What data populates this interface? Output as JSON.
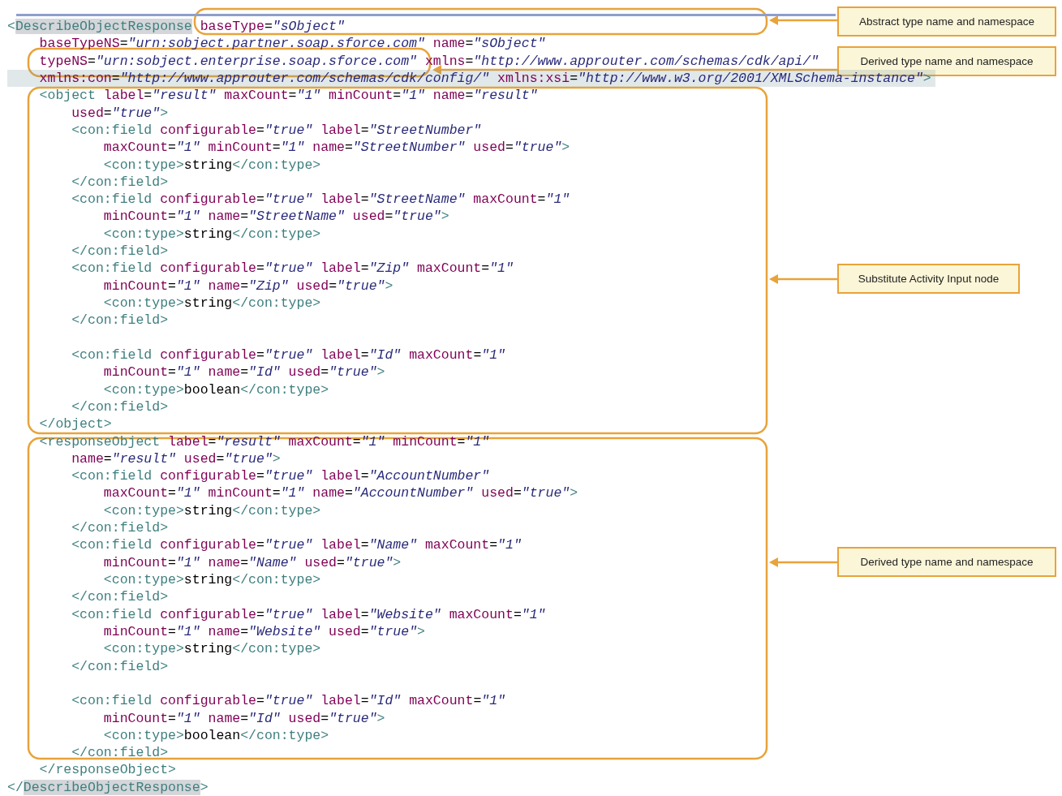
{
  "code_lines": [
    {
      "kind": "code",
      "highlighted": false,
      "segments": [
        {
          "kind": "tag",
          "text": "<"
        },
        {
          "kind": "tag",
          "text": "DescribeObjectResponse",
          "highlighted": true
        },
        {
          "kind": "attr",
          "text": " baseType"
        },
        {
          "kind": "eq",
          "text": "="
        },
        {
          "kind": "value",
          "text": "\"sObject\""
        }
      ]
    },
    {
      "kind": "code",
      "highlighted": false,
      "segments": [
        {
          "kind": "attr",
          "text": "    baseTypeNS"
        },
        {
          "kind": "eq",
          "text": "="
        },
        {
          "kind": "value",
          "text": "\"urn:sobject.partner.soap.sforce.com\""
        },
        {
          "kind": "attr",
          "text": " name"
        },
        {
          "kind": "eq",
          "text": "="
        },
        {
          "kind": "value",
          "text": "\"sObject\""
        }
      ]
    },
    {
      "kind": "code",
      "highlighted": false,
      "segments": [
        {
          "kind": "attr",
          "text": "    typeNS"
        },
        {
          "kind": "eq",
          "text": "="
        },
        {
          "kind": "value",
          "text": "\"urn:sobject.enterprise.soap.sforce.com\""
        }
      ],
      "tail_segments": [
        {
          "kind": "attr",
          "text": " xmlns"
        },
        {
          "kind": "eq",
          "text": "="
        },
        {
          "kind": "value",
          "text": "\"http://www.approuter.com/schemas/cdk/api/\""
        }
      ]
    },
    {
      "kind": "code",
      "highlighted": true,
      "segments": [
        {
          "kind": "attr",
          "text": "    xmlns:con"
        },
        {
          "kind": "eq",
          "text": "="
        },
        {
          "kind": "value",
          "text": "\"http://www.approuter.com/schemas/cdk/config/\""
        },
        {
          "kind": "attr",
          "text": " xmlns:xsi"
        },
        {
          "kind": "eq",
          "text": "="
        },
        {
          "kind": "value",
          "text": "\"http://www.w3.org/2001/XMLSchema-instance\""
        },
        {
          "kind": "tag",
          "text": ">"
        }
      ]
    },
    {
      "kind": "code",
      "highlighted": false,
      "segments": [
        {
          "kind": "tag",
          "text": "    <object"
        },
        {
          "kind": "attr",
          "text": " label"
        },
        {
          "kind": "eq",
          "text": "="
        },
        {
          "kind": "value",
          "text": "\"result\""
        },
        {
          "kind": "attr",
          "text": " maxCount"
        },
        {
          "kind": "eq",
          "text": "="
        },
        {
          "kind": "value",
          "text": "\"1\""
        },
        {
          "kind": "attr",
          "text": " minCount"
        },
        {
          "kind": "eq",
          "text": "="
        },
        {
          "kind": "value",
          "text": "\"1\""
        },
        {
          "kind": "attr",
          "text": " name"
        },
        {
          "kind": "eq",
          "text": "="
        },
        {
          "kind": "value",
          "text": "\"result\""
        }
      ]
    },
    {
      "kind": "code",
      "highlighted": false,
      "segments": [
        {
          "kind": "attr",
          "text": "        used"
        },
        {
          "kind": "eq",
          "text": "="
        },
        {
          "kind": "value",
          "text": "\"true\""
        },
        {
          "kind": "tag",
          "text": ">"
        }
      ]
    },
    {
      "kind": "code",
      "highlighted": false,
      "segments": [
        {
          "kind": "tag",
          "text": "        <con:field"
        },
        {
          "kind": "attr",
          "text": " configurable"
        },
        {
          "kind": "eq",
          "text": "="
        },
        {
          "kind": "value",
          "text": "\"true\""
        },
        {
          "kind": "attr",
          "text": " label"
        },
        {
          "kind": "eq",
          "text": "="
        },
        {
          "kind": "value",
          "text": "\"StreetNumber\""
        }
      ]
    },
    {
      "kind": "code",
      "highlighted": false,
      "segments": [
        {
          "kind": "attr",
          "text": "            maxCount"
        },
        {
          "kind": "eq",
          "text": "="
        },
        {
          "kind": "value",
          "text": "\"1\""
        },
        {
          "kind": "attr",
          "text": " minCount"
        },
        {
          "kind": "eq",
          "text": "="
        },
        {
          "kind": "value",
          "text": "\"1\""
        },
        {
          "kind": "attr",
          "text": " name"
        },
        {
          "kind": "eq",
          "text": "="
        },
        {
          "kind": "value",
          "text": "\"StreetNumber\""
        },
        {
          "kind": "attr",
          "text": " used"
        },
        {
          "kind": "eq",
          "text": "="
        },
        {
          "kind": "value",
          "text": "\"true\""
        },
        {
          "kind": "tag",
          "text": ">"
        }
      ]
    },
    {
      "kind": "code",
      "highlighted": false,
      "segments": [
        {
          "kind": "tag",
          "text": "            <con:type>"
        },
        {
          "kind": "text",
          "text": "string"
        },
        {
          "kind": "tag",
          "text": "</con:type>"
        }
      ]
    },
    {
      "kind": "code",
      "highlighted": false,
      "segments": [
        {
          "kind": "tag",
          "text": "        </con:field>"
        }
      ]
    },
    {
      "kind": "code",
      "highlighted": false,
      "segments": [
        {
          "kind": "tag",
          "text": "        <con:field"
        },
        {
          "kind": "attr",
          "text": " configurable"
        },
        {
          "kind": "eq",
          "text": "="
        },
        {
          "kind": "value",
          "text": "\"true\""
        },
        {
          "kind": "attr",
          "text": " label"
        },
        {
          "kind": "eq",
          "text": "="
        },
        {
          "kind": "value",
          "text": "\"StreetName\""
        },
        {
          "kind": "attr",
          "text": " maxCount"
        },
        {
          "kind": "eq",
          "text": "="
        },
        {
          "kind": "value",
          "text": "\"1\""
        }
      ]
    },
    {
      "kind": "code",
      "highlighted": false,
      "segments": [
        {
          "kind": "attr",
          "text": "            minCount"
        },
        {
          "kind": "eq",
          "text": "="
        },
        {
          "kind": "value",
          "text": "\"1\""
        },
        {
          "kind": "attr",
          "text": " name"
        },
        {
          "kind": "eq",
          "text": "="
        },
        {
          "kind": "value",
          "text": "\"StreetName\""
        },
        {
          "kind": "attr",
          "text": " used"
        },
        {
          "kind": "eq",
          "text": "="
        },
        {
          "kind": "value",
          "text": "\"true\""
        },
        {
          "kind": "tag",
          "text": ">"
        }
      ]
    },
    {
      "kind": "code",
      "highlighted": false,
      "segments": [
        {
          "kind": "tag",
          "text": "            <con:type>"
        },
        {
          "kind": "text",
          "text": "string"
        },
        {
          "kind": "tag",
          "text": "</con:type>"
        }
      ]
    },
    {
      "kind": "code",
      "highlighted": false,
      "segments": [
        {
          "kind": "tag",
          "text": "        </con:field>"
        }
      ]
    },
    {
      "kind": "code",
      "highlighted": false,
      "segments": [
        {
          "kind": "tag",
          "text": "        <con:field"
        },
        {
          "kind": "attr",
          "text": " configurable"
        },
        {
          "kind": "eq",
          "text": "="
        },
        {
          "kind": "value",
          "text": "\"true\""
        },
        {
          "kind": "attr",
          "text": " label"
        },
        {
          "kind": "eq",
          "text": "="
        },
        {
          "kind": "value",
          "text": "\"Zip\""
        },
        {
          "kind": "attr",
          "text": " maxCount"
        },
        {
          "kind": "eq",
          "text": "="
        },
        {
          "kind": "value",
          "text": "\"1\""
        }
      ]
    },
    {
      "kind": "code",
      "highlighted": false,
      "segments": [
        {
          "kind": "attr",
          "text": "            minCount"
        },
        {
          "kind": "eq",
          "text": "="
        },
        {
          "kind": "value",
          "text": "\"1\""
        },
        {
          "kind": "attr",
          "text": " name"
        },
        {
          "kind": "eq",
          "text": "="
        },
        {
          "kind": "value",
          "text": "\"Zip\""
        },
        {
          "kind": "attr",
          "text": " used"
        },
        {
          "kind": "eq",
          "text": "="
        },
        {
          "kind": "value",
          "text": "\"true\""
        },
        {
          "kind": "tag",
          "text": ">"
        }
      ]
    },
    {
      "kind": "code",
      "highlighted": false,
      "segments": [
        {
          "kind": "tag",
          "text": "            <con:type>"
        },
        {
          "kind": "text",
          "text": "string"
        },
        {
          "kind": "tag",
          "text": "</con:type>"
        }
      ]
    },
    {
      "kind": "code",
      "highlighted": false,
      "segments": [
        {
          "kind": "tag",
          "text": "        </con:field>"
        }
      ]
    },
    {
      "kind": "blank",
      "highlighted": false
    },
    {
      "kind": "code",
      "highlighted": false,
      "segments": [
        {
          "kind": "tag",
          "text": "        <con:field"
        },
        {
          "kind": "attr",
          "text": " configurable"
        },
        {
          "kind": "eq",
          "text": "="
        },
        {
          "kind": "value",
          "text": "\"true\""
        },
        {
          "kind": "attr",
          "text": " label"
        },
        {
          "kind": "eq",
          "text": "="
        },
        {
          "kind": "value",
          "text": "\"Id\""
        },
        {
          "kind": "attr",
          "text": " maxCount"
        },
        {
          "kind": "eq",
          "text": "="
        },
        {
          "kind": "value",
          "text": "\"1\""
        }
      ]
    },
    {
      "kind": "code",
      "highlighted": false,
      "segments": [
        {
          "kind": "attr",
          "text": "            minCount"
        },
        {
          "kind": "eq",
          "text": "="
        },
        {
          "kind": "value",
          "text": "\"1\""
        },
        {
          "kind": "attr",
          "text": " name"
        },
        {
          "kind": "eq",
          "text": "="
        },
        {
          "kind": "value",
          "text": "\"Id\""
        },
        {
          "kind": "attr",
          "text": " used"
        },
        {
          "kind": "eq",
          "text": "="
        },
        {
          "kind": "value",
          "text": "\"true\""
        },
        {
          "kind": "tag",
          "text": ">"
        }
      ]
    },
    {
      "kind": "code",
      "highlighted": false,
      "segments": [
        {
          "kind": "tag",
          "text": "            <con:type>"
        },
        {
          "kind": "text",
          "text": "boolean"
        },
        {
          "kind": "tag",
          "text": "</con:type>"
        }
      ]
    },
    {
      "kind": "code",
      "highlighted": false,
      "segments": [
        {
          "kind": "tag",
          "text": "        </con:field>"
        }
      ]
    },
    {
      "kind": "code",
      "highlighted": false,
      "segments": [
        {
          "kind": "tag",
          "text": "    </object>"
        }
      ]
    },
    {
      "kind": "code",
      "highlighted": false,
      "segments": [
        {
          "kind": "tag",
          "text": "    <responseObject"
        },
        {
          "kind": "attr",
          "text": " label"
        },
        {
          "kind": "eq",
          "text": "="
        },
        {
          "kind": "value",
          "text": "\"result\""
        },
        {
          "kind": "attr",
          "text": " maxCount"
        },
        {
          "kind": "eq",
          "text": "="
        },
        {
          "kind": "value",
          "text": "\"1\""
        },
        {
          "kind": "attr",
          "text": " minCount"
        },
        {
          "kind": "eq",
          "text": "="
        },
        {
          "kind": "value",
          "text": "\"1\""
        }
      ]
    },
    {
      "kind": "code",
      "highlighted": false,
      "segments": [
        {
          "kind": "attr",
          "text": "        name"
        },
        {
          "kind": "eq",
          "text": "="
        },
        {
          "kind": "value",
          "text": "\"result\""
        },
        {
          "kind": "attr",
          "text": " used"
        },
        {
          "kind": "eq",
          "text": "="
        },
        {
          "kind": "value",
          "text": "\"true\""
        },
        {
          "kind": "tag",
          "text": ">"
        }
      ]
    },
    {
      "kind": "code",
      "highlighted": false,
      "segments": [
        {
          "kind": "tag",
          "text": "        <con:field"
        },
        {
          "kind": "attr",
          "text": " configurable"
        },
        {
          "kind": "eq",
          "text": "="
        },
        {
          "kind": "value",
          "text": "\"true\""
        },
        {
          "kind": "attr",
          "text": " label"
        },
        {
          "kind": "eq",
          "text": "="
        },
        {
          "kind": "value",
          "text": "\"AccountNumber\""
        }
      ]
    },
    {
      "kind": "code",
      "highlighted": false,
      "segments": [
        {
          "kind": "attr",
          "text": "            maxCount"
        },
        {
          "kind": "eq",
          "text": "="
        },
        {
          "kind": "value",
          "text": "\"1\""
        },
        {
          "kind": "attr",
          "text": " minCount"
        },
        {
          "kind": "eq",
          "text": "="
        },
        {
          "kind": "value",
          "text": "\"1\""
        },
        {
          "kind": "attr",
          "text": " name"
        },
        {
          "kind": "eq",
          "text": "="
        },
        {
          "kind": "value",
          "text": "\"AccountNumber\""
        },
        {
          "kind": "attr",
          "text": " used"
        },
        {
          "kind": "eq",
          "text": "="
        },
        {
          "kind": "value",
          "text": "\"true\""
        },
        {
          "kind": "tag",
          "text": ">"
        }
      ]
    },
    {
      "kind": "code",
      "highlighted": false,
      "segments": [
        {
          "kind": "tag",
          "text": "            <con:type>"
        },
        {
          "kind": "text",
          "text": "string"
        },
        {
          "kind": "tag",
          "text": "</con:type>"
        }
      ]
    },
    {
      "kind": "code",
      "highlighted": false,
      "segments": [
        {
          "kind": "tag",
          "text": "        </con:field>"
        }
      ]
    },
    {
      "kind": "code",
      "highlighted": false,
      "segments": [
        {
          "kind": "tag",
          "text": "        <con:field"
        },
        {
          "kind": "attr",
          "text": " configurable"
        },
        {
          "kind": "eq",
          "text": "="
        },
        {
          "kind": "value",
          "text": "\"true\""
        },
        {
          "kind": "attr",
          "text": " label"
        },
        {
          "kind": "eq",
          "text": "="
        },
        {
          "kind": "value",
          "text": "\"Name\""
        },
        {
          "kind": "attr",
          "text": " maxCount"
        },
        {
          "kind": "eq",
          "text": "="
        },
        {
          "kind": "value",
          "text": "\"1\""
        }
      ]
    },
    {
      "kind": "code",
      "highlighted": false,
      "segments": [
        {
          "kind": "attr",
          "text": "            minCount"
        },
        {
          "kind": "eq",
          "text": "="
        },
        {
          "kind": "value",
          "text": "\"1\""
        },
        {
          "kind": "attr",
          "text": " name"
        },
        {
          "kind": "eq",
          "text": "="
        },
        {
          "kind": "value",
          "text": "\"Name\""
        },
        {
          "kind": "attr",
          "text": " used"
        },
        {
          "kind": "eq",
          "text": "="
        },
        {
          "kind": "value",
          "text": "\"true\""
        },
        {
          "kind": "tag",
          "text": ">"
        }
      ]
    },
    {
      "kind": "code",
      "highlighted": false,
      "segments": [
        {
          "kind": "tag",
          "text": "            <con:type>"
        },
        {
          "kind": "text",
          "text": "string"
        },
        {
          "kind": "tag",
          "text": "</con:type>"
        }
      ]
    },
    {
      "kind": "code",
      "highlighted": false,
      "segments": [
        {
          "kind": "tag",
          "text": "        </con:field>"
        }
      ]
    },
    {
      "kind": "code",
      "highlighted": false,
      "segments": [
        {
          "kind": "tag",
          "text": "        <con:field"
        },
        {
          "kind": "attr",
          "text": " configurable"
        },
        {
          "kind": "eq",
          "text": "="
        },
        {
          "kind": "value",
          "text": "\"true\""
        },
        {
          "kind": "attr",
          "text": " label"
        },
        {
          "kind": "eq",
          "text": "="
        },
        {
          "kind": "value",
          "text": "\"Website\""
        },
        {
          "kind": "attr",
          "text": " maxCount"
        },
        {
          "kind": "eq",
          "text": "="
        },
        {
          "kind": "value",
          "text": "\"1\""
        }
      ]
    },
    {
      "kind": "code",
      "highlighted": false,
      "segments": [
        {
          "kind": "attr",
          "text": "            minCount"
        },
        {
          "kind": "eq",
          "text": "="
        },
        {
          "kind": "value",
          "text": "\"1\""
        },
        {
          "kind": "attr",
          "text": " name"
        },
        {
          "kind": "eq",
          "text": "="
        },
        {
          "kind": "value",
          "text": "\"Website\""
        },
        {
          "kind": "attr",
          "text": " used"
        },
        {
          "kind": "eq",
          "text": "="
        },
        {
          "kind": "value",
          "text": "\"true\""
        },
        {
          "kind": "tag",
          "text": ">"
        }
      ]
    },
    {
      "kind": "code",
      "highlighted": false,
      "segments": [
        {
          "kind": "tag",
          "text": "            <con:type>"
        },
        {
          "kind": "text",
          "text": "string"
        },
        {
          "kind": "tag",
          "text": "</con:type>"
        }
      ]
    },
    {
      "kind": "code",
      "highlighted": false,
      "segments": [
        {
          "kind": "tag",
          "text": "        </con:field>"
        }
      ]
    },
    {
      "kind": "blank",
      "highlighted": false
    },
    {
      "kind": "code",
      "highlighted": false,
      "segments": [
        {
          "kind": "tag",
          "text": "        <con:field"
        },
        {
          "kind": "attr",
          "text": " configurable"
        },
        {
          "kind": "eq",
          "text": "="
        },
        {
          "kind": "value",
          "text": "\"true\""
        },
        {
          "kind": "attr",
          "text": " label"
        },
        {
          "kind": "eq",
          "text": "="
        },
        {
          "kind": "value",
          "text": "\"Id\""
        },
        {
          "kind": "attr",
          "text": " maxCount"
        },
        {
          "kind": "eq",
          "text": "="
        },
        {
          "kind": "value",
          "text": "\"1\""
        }
      ]
    },
    {
      "kind": "code",
      "highlighted": false,
      "segments": [
        {
          "kind": "attr",
          "text": "            minCount"
        },
        {
          "kind": "eq",
          "text": "="
        },
        {
          "kind": "value",
          "text": "\"1\""
        },
        {
          "kind": "attr",
          "text": " name"
        },
        {
          "kind": "eq",
          "text": "="
        },
        {
          "kind": "value",
          "text": "\"Id\""
        },
        {
          "kind": "attr",
          "text": " used"
        },
        {
          "kind": "eq",
          "text": "="
        },
        {
          "kind": "value",
          "text": "\"true\""
        },
        {
          "kind": "tag",
          "text": ">"
        }
      ]
    },
    {
      "kind": "code",
      "highlighted": false,
      "segments": [
        {
          "kind": "tag",
          "text": "            <con:type>"
        },
        {
          "kind": "text",
          "text": "boolean"
        },
        {
          "kind": "tag",
          "text": "</con:type>"
        }
      ]
    },
    {
      "kind": "code",
      "highlighted": false,
      "segments": [
        {
          "kind": "tag",
          "text": "        </con:field>"
        }
      ]
    },
    {
      "kind": "code",
      "highlighted": false,
      "segments": [
        {
          "kind": "tag",
          "text": "    </responseObject>"
        }
      ]
    },
    {
      "kind": "code",
      "highlighted": false,
      "segments": [
        {
          "kind": "tag",
          "text": "</"
        },
        {
          "kind": "tag",
          "text": "DescribeObjectResponse",
          "highlighted": true
        },
        {
          "kind": "tag",
          "text": ">"
        }
      ]
    }
  ],
  "callouts": [
    {
      "label": "Abstract type name and namespace"
    },
    {
      "label": "Derived type name and namespace"
    },
    {
      "label": "Substitute Activity Input node"
    },
    {
      "label": "Derived type name and namespace"
    }
  ]
}
